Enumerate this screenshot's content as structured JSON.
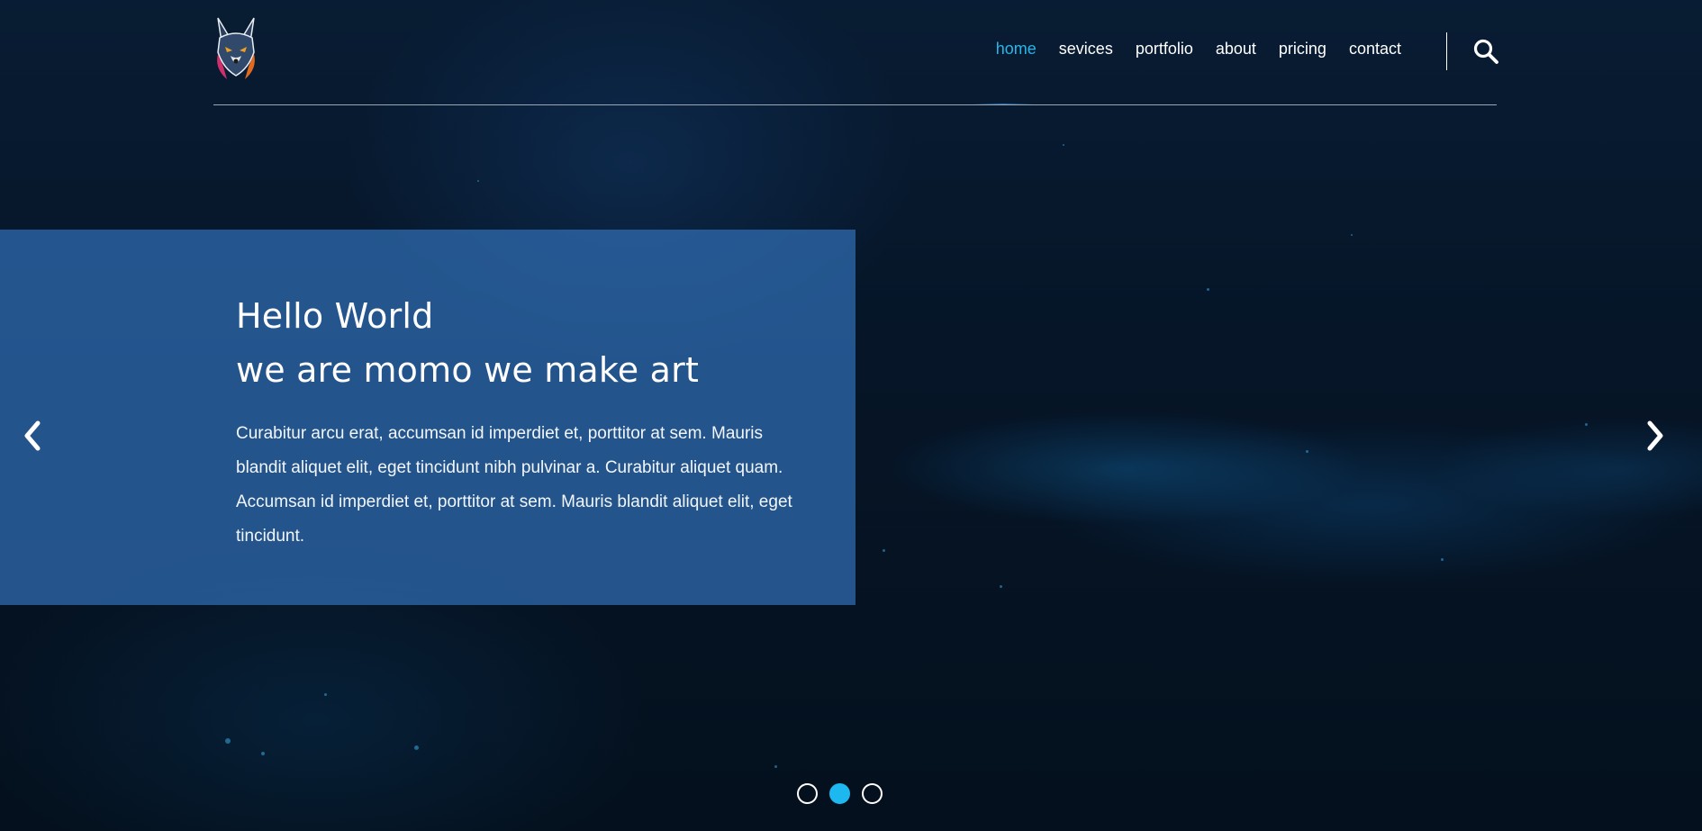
{
  "header": {
    "logo_icon": "wolf-head-logo",
    "nav": [
      {
        "label": "home",
        "active": true
      },
      {
        "label": "sevices",
        "active": false
      },
      {
        "label": "portfolio",
        "active": false
      },
      {
        "label": "about",
        "active": false
      },
      {
        "label": "pricing",
        "active": false
      },
      {
        "label": "contact",
        "active": false
      }
    ],
    "search_icon": "search-icon"
  },
  "hero": {
    "title_line1": "Hello World",
    "title_line2": "we are momo we make art",
    "paragraph": "Curabitur arcu erat, accumsan id imperdiet et, porttitor at sem. Mauris blandit aliquet elit, eget tincidunt nibh pulvinar a. Curabitur aliquet quam. Accumsan id imperdiet et, porttitor at sem. Mauris blandit aliquet elit, eget tincidunt.",
    "prev_icon": "chevron-left-icon",
    "next_icon": "chevron-right-icon",
    "slide_count": 3,
    "active_slide": 2
  },
  "colors": {
    "accent": "#27b6ea",
    "caption_bg": "#306eb4",
    "background": "#061527"
  }
}
